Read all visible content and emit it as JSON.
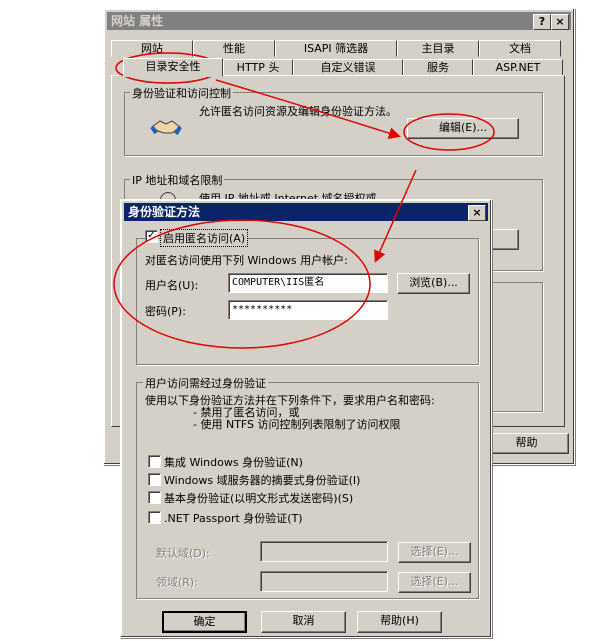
{
  "back_window": {
    "title": "网站 属性",
    "help_glyph": "?",
    "close_glyph": "×",
    "tabs_row1": [
      "网站",
      "性能",
      "ISAPI 筛选器",
      "主目录",
      "文档"
    ],
    "tabs_row2": [
      "目录安全性",
      "HTTP 头",
      "自定义错误",
      "服务",
      "ASP.NET"
    ],
    "auth_group_label": "身份验证和访问控制",
    "auth_desc": "允许匿名访问资源及编辑身份验证方法。",
    "edit_button": "编辑(E)...",
    "ip_group_label": "IP 地址和域名限制",
    "ip_desc": "使用 IP 地址或 Internet 域名授权或",
    "help_button": "帮助"
  },
  "dialog": {
    "title": "身份验证方法",
    "close_glyph": "×",
    "enable_anonymous": "启用匿名访问(A)",
    "anonymous_desc": "对匿名访问使用下列 Windows 用户帐户:",
    "username_label": "用户名(U):",
    "username_value": "COMPUTER\\IIS匿名",
    "browse_button": "浏览(B)...",
    "password_label": "密码(P):",
    "password_value": "**********",
    "auth_group_label": "用户访问需经过身份验证",
    "auth_desc_line1": "使用以下身份验证方法并在下列条件下，要求用户名和密码:",
    "auth_desc_line2": "-  禁用了匿名访问，或",
    "auth_desc_line3": "-  使用 NTFS 访问控制列表限制了访问权限",
    "options": [
      "集成 Windows 身份验证(N)",
      "Windows 域服务器的摘要式身份验证(I)",
      "基本身份验证(以明文形式发送密码)(S)",
      ".NET Passport 身份验证(T)"
    ],
    "default_domain_label": "默认域(D):",
    "realm_label": "领域(R):",
    "select_button": "选择(E)...",
    "select_button2": "选择(E)...",
    "ok_button": "确定",
    "cancel_button": "取消",
    "help_button": "帮助(H)"
  },
  "annotation_color": "#e00000"
}
